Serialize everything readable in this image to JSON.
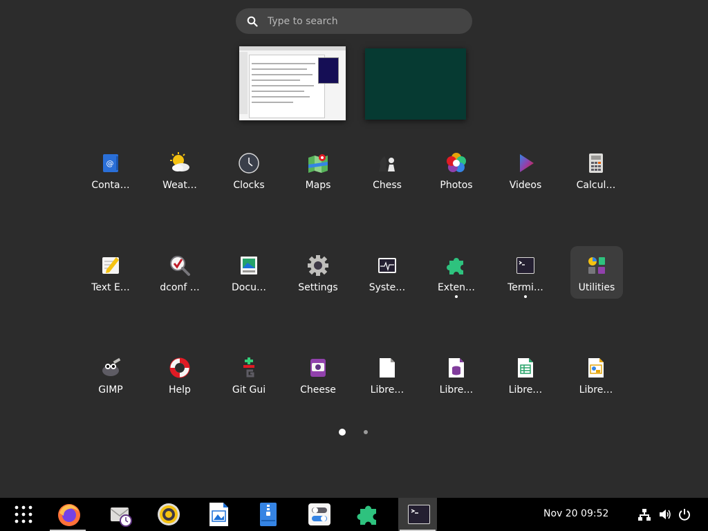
{
  "search": {
    "placeholder": "Type to search"
  },
  "apps": [
    {
      "label": "Conta…",
      "icon": "contacts-icon"
    },
    {
      "label": "Weat…",
      "icon": "weather-icon"
    },
    {
      "label": "Clocks",
      "icon": "clocks-icon"
    },
    {
      "label": "Maps",
      "icon": "maps-icon"
    },
    {
      "label": "Chess",
      "icon": "chess-icon"
    },
    {
      "label": "Photos",
      "icon": "photos-icon"
    },
    {
      "label": "Videos",
      "icon": "videos-icon"
    },
    {
      "label": "Calcul…",
      "icon": "calculator-icon"
    },
    {
      "label": "Text E…",
      "icon": "text-editor-icon"
    },
    {
      "label": "dconf …",
      "icon": "dconf-editor-icon"
    },
    {
      "label": "Docu…",
      "icon": "document-viewer-icon"
    },
    {
      "label": "Settings",
      "icon": "settings-gear-icon"
    },
    {
      "label": "Syste…",
      "icon": "system-monitor-icon"
    },
    {
      "label": "Exten…",
      "icon": "extensions-puzzle-icon",
      "running": true
    },
    {
      "label": "Termi…",
      "icon": "terminal-icon",
      "running": true
    },
    {
      "label": "Utilities",
      "icon": "utilities-folder-icon"
    },
    {
      "label": "GIMP",
      "icon": "gimp-icon"
    },
    {
      "label": "Help",
      "icon": "help-lifebuoy-icon"
    },
    {
      "label": "Git Gui",
      "icon": "git-gui-icon"
    },
    {
      "label": "Cheese",
      "icon": "cheese-icon"
    },
    {
      "label": "Libre…",
      "icon": "libreoffice-icon"
    },
    {
      "label": "Libre…",
      "icon": "libreoffice-base-icon"
    },
    {
      "label": "Libre…",
      "icon": "libreoffice-calc-icon"
    },
    {
      "label": "Libre…",
      "icon": "libreoffice-impress-icon"
    }
  ],
  "pager": {
    "pages": 2,
    "current": 1
  },
  "taskbar": {
    "items": [
      {
        "icon": "app-grid-icon"
      },
      {
        "icon": "firefox-icon",
        "running": true
      },
      {
        "icon": "evolution-mail-icon"
      },
      {
        "icon": "rhythmbox-icon"
      },
      {
        "icon": "libreoffice-writer-icon"
      },
      {
        "icon": "file-roller-icon"
      },
      {
        "icon": "tweaks-icon"
      },
      {
        "icon": "extensions-icon"
      },
      {
        "icon": "terminal-icon",
        "active": true
      }
    ],
    "clock": "Nov 20  09:52",
    "tray": [
      "network-icon",
      "volume-icon",
      "power-icon"
    ]
  },
  "colors": {
    "background": "#2c2c2c",
    "search_bg": "#444444",
    "taskbar_bg": "#000000",
    "highlight": "#3d3d3d"
  }
}
